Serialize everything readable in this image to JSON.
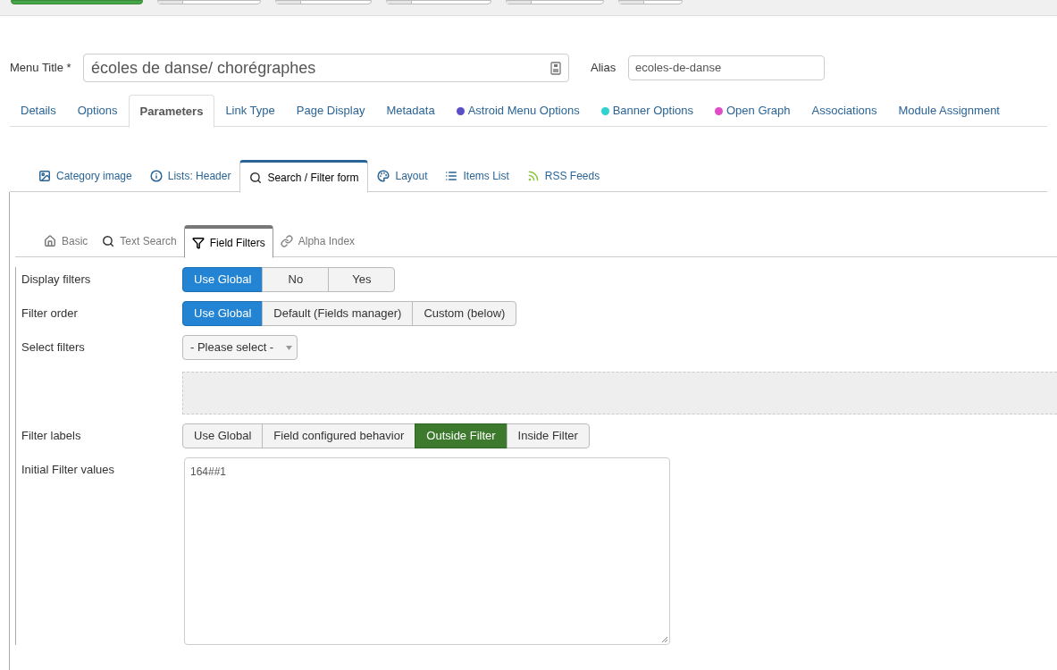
{
  "toolbar": {
    "buttons": [
      {
        "kind": "primary"
      },
      {
        "kind": "split"
      },
      {
        "kind": "split"
      },
      {
        "kind": "split"
      },
      {
        "kind": "split"
      },
      {
        "kind": "split"
      }
    ]
  },
  "title_field": {
    "label": "Menu Title *",
    "value": "écoles de danse/ chorégraphes"
  },
  "alias_field": {
    "label": "Alias",
    "value": "ecoles-de-danse"
  },
  "tabs": [
    {
      "label": "Details",
      "selected": false
    },
    {
      "label": "Options",
      "selected": false
    },
    {
      "label": "Parameters",
      "selected": true
    },
    {
      "label": "Link Type",
      "selected": false
    },
    {
      "label": "Page Display",
      "selected": false
    },
    {
      "label": "Metadata",
      "selected": false
    },
    {
      "label": "Astroid Menu Options",
      "selected": false,
      "color": "#5b4fc8"
    },
    {
      "label": "Banner Options",
      "selected": false,
      "color": "#2ed3d0"
    },
    {
      "label": "Open Graph",
      "selected": false,
      "color": "#e04bc8"
    },
    {
      "label": "Associations",
      "selected": false
    },
    {
      "label": "Module Assignment",
      "selected": false
    }
  ],
  "sub_tabs": [
    {
      "label": "Category image",
      "kind": "image",
      "selected": false
    },
    {
      "label": "Lists: Header",
      "kind": "info",
      "selected": false
    },
    {
      "label": "Search / Filter form",
      "kind": "search",
      "selected": true
    },
    {
      "label": "Layout",
      "kind": "palette",
      "selected": false
    },
    {
      "label": "Items List",
      "kind": "list",
      "selected": false
    },
    {
      "label": "RSS Feeds",
      "kind": "rss",
      "selected": false
    }
  ],
  "inner_tabs": [
    {
      "label": "Basic",
      "kind": "home",
      "selected": false
    },
    {
      "label": "Text Search",
      "kind": "search",
      "selected": false
    },
    {
      "label": "Field Filters",
      "kind": "filter",
      "selected": true
    },
    {
      "label": "Alpha Index",
      "kind": "link",
      "selected": false
    }
  ],
  "fields": [
    {
      "kind": "radio",
      "label": "Display filters",
      "options": [
        {
          "label": "Use Global",
          "selected": true
        },
        {
          "label": "No",
          "selected": false
        },
        {
          "label": "Yes",
          "selected": false
        }
      ]
    },
    {
      "kind": "radio",
      "label": "Filter order",
      "options": [
        {
          "label": "Use Global",
          "selected": true
        },
        {
          "label": "Default (Fields manager)",
          "selected": false
        },
        {
          "label": "Custom (below)",
          "selected": false
        }
      ]
    },
    {
      "kind": "select",
      "label": "Select filters",
      "value": "- Please select -"
    },
    {
      "kind": "radio",
      "label": "Filter labels",
      "options": [
        {
          "label": "Use Global",
          "selected": false
        },
        {
          "label": "Field configured behavior",
          "selected": false
        },
        {
          "label": "Outside Filter",
          "selected": true
        },
        {
          "label": "Inside Filter",
          "selected": false
        }
      ]
    },
    {
      "kind": "textarea",
      "label": "Initial Filter values",
      "value": "164##1"
    }
  ]
}
